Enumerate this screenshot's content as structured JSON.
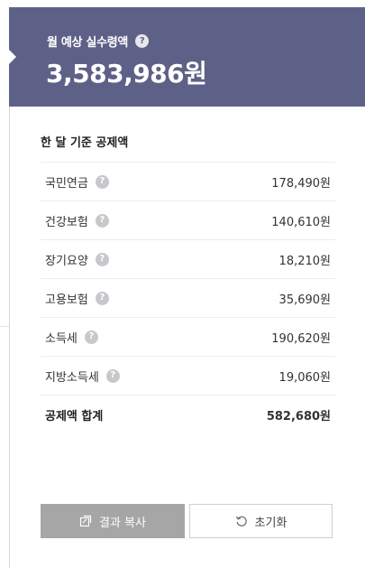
{
  "header": {
    "label": "월 예상 실수령액",
    "amount": "3,583,986원",
    "help_symbol": "?"
  },
  "deductions": {
    "title": "한 달 기준 공제액",
    "items": [
      {
        "label": "국민연금",
        "value": "178,490원"
      },
      {
        "label": "건강보험",
        "value": "140,610원"
      },
      {
        "label": "장기요양",
        "value": "18,210원"
      },
      {
        "label": "고용보험",
        "value": "35,690원"
      },
      {
        "label": "소득세",
        "value": "190,620원"
      },
      {
        "label": "지방소득세",
        "value": "19,060원"
      }
    ],
    "total_label": "공제액 합계",
    "total_value": "582,680원"
  },
  "actions": {
    "copy_label": "결과 복사",
    "reset_label": "초기화"
  },
  "colors": {
    "header_bg": "#5e6187",
    "copy_button_bg": "#a6a6a6"
  },
  "icons": [
    "help-icon",
    "copy-icon",
    "refresh-icon"
  ]
}
